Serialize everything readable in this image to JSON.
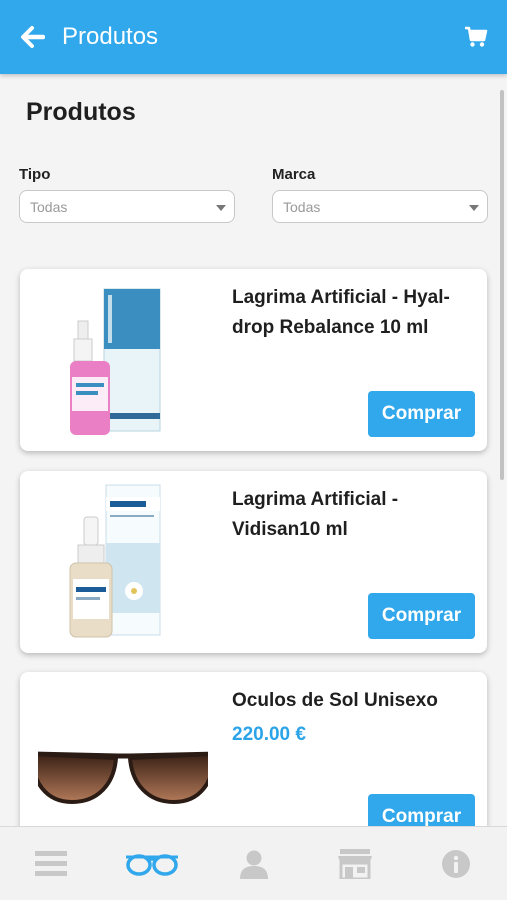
{
  "header": {
    "title": "Produtos",
    "back_icon": "arrow-left-icon",
    "cart_icon": "shopping-cart-icon",
    "background": "#31a8ec"
  },
  "page": {
    "heading": "Produtos"
  },
  "filters": {
    "tipo": {
      "label": "Tipo",
      "value": "Todas"
    },
    "marca": {
      "label": "Marca",
      "value": "Todas"
    }
  },
  "products": [
    {
      "name": "Lagrima Artificial - Hyal-drop Rebalance 10 ml",
      "price": "",
      "button": "Comprar",
      "image": "hyal-drop-eye-drops-image"
    },
    {
      "name": "Lagrima Artificial - Vidisan10 ml",
      "price": "",
      "button": "Comprar",
      "image": "vidisan-eye-drops-image"
    },
    {
      "name": "Oculos de Sol Unisexo",
      "price": "220.00 €",
      "button": "Comprar",
      "image": "sunglasses-image"
    }
  ],
  "bottom_nav": [
    {
      "icon": "menu-icon",
      "active": false
    },
    {
      "icon": "glasses-icon",
      "active": true
    },
    {
      "icon": "user-icon",
      "active": false
    },
    {
      "icon": "store-icon",
      "active": false
    },
    {
      "icon": "info-icon",
      "active": false
    }
  ],
  "colors": {
    "accent": "#31a8ec",
    "price": "#2aa3e8",
    "nav_inactive": "#c8c8c8"
  }
}
